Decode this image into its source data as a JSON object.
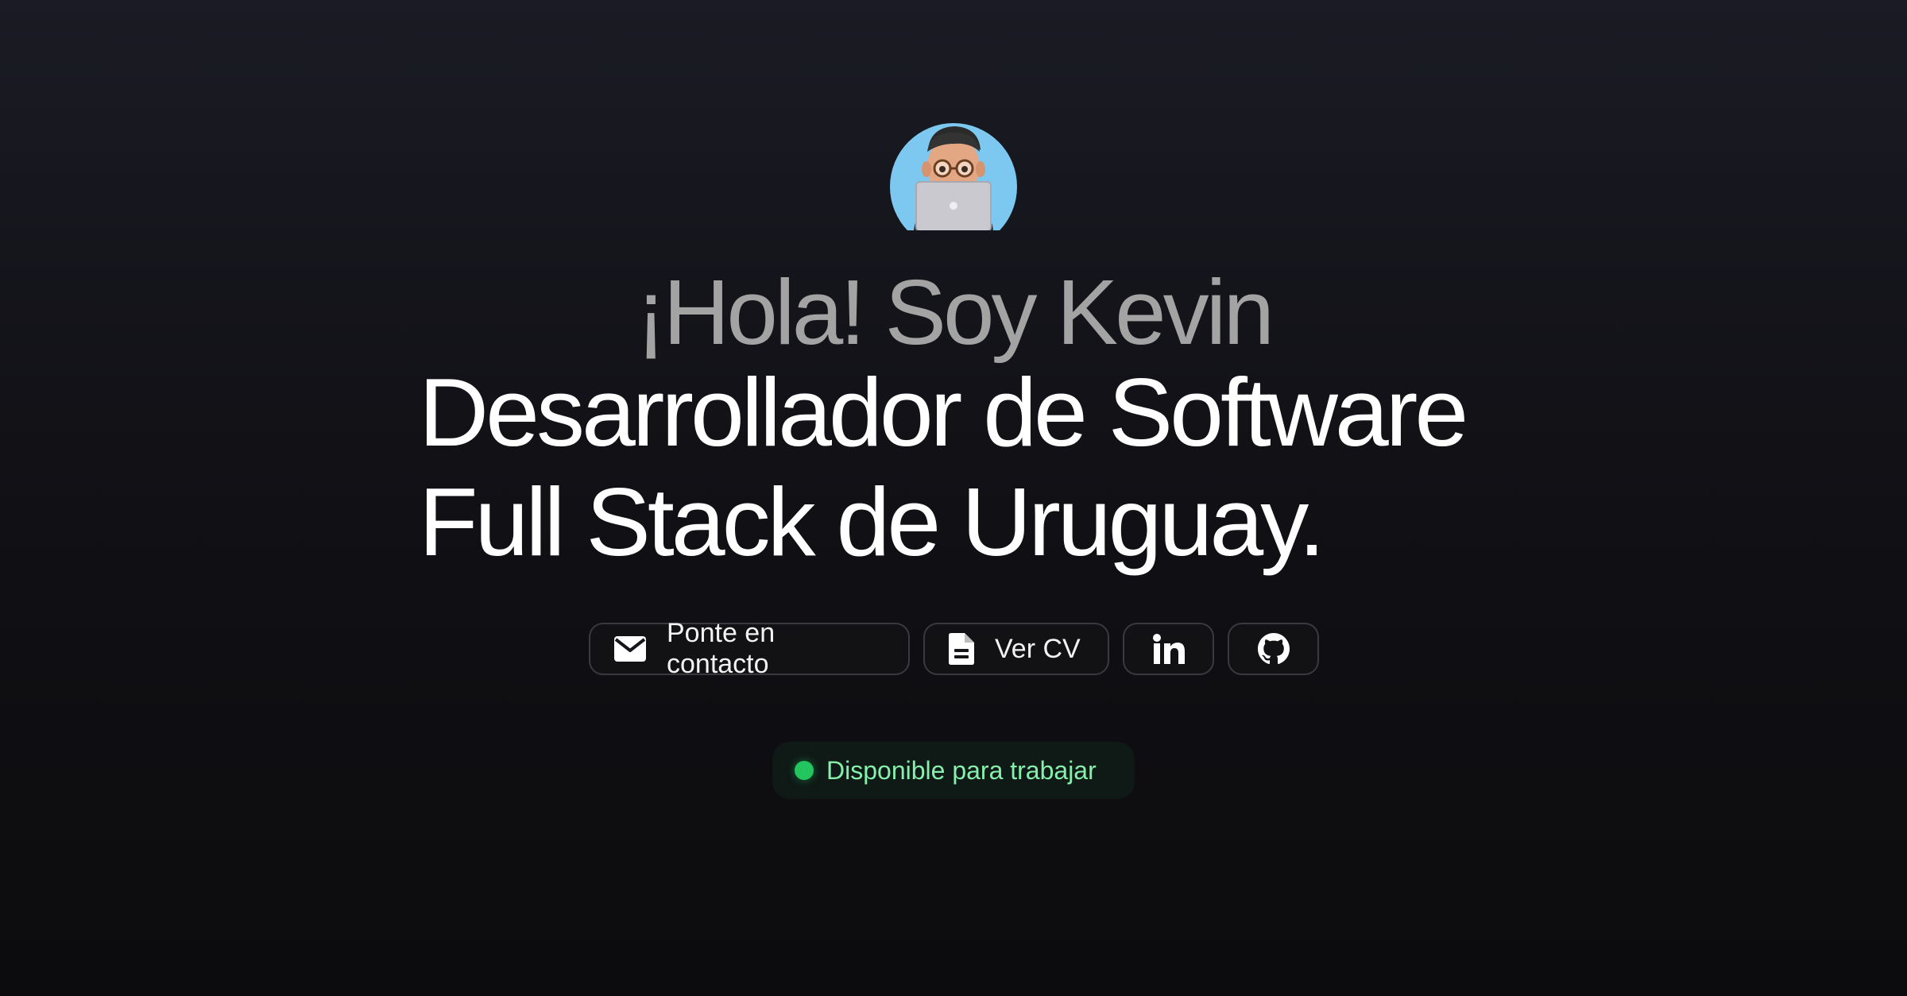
{
  "hero": {
    "avatar_icon": "memoji-developer-laptop-icon",
    "greeting": "¡Hola! Soy Kevin",
    "headline_line1": "Desarrollador de Software",
    "headline_line2": "Full Stack de Uruguay."
  },
  "actions": {
    "contact_label": "Ponte en contacto",
    "contact_icon": "mail-icon",
    "cv_label": "Ver CV",
    "cv_icon": "document-icon",
    "linkedin_icon": "linkedin-icon",
    "github_icon": "github-icon"
  },
  "status": {
    "label": "Disponible para trabajar",
    "color": "#22c55e"
  },
  "colors": {
    "background": "#111116",
    "greeting": "#a3a3a3",
    "headline": "#ffffff",
    "button_border": "#3a3a3e",
    "status_text": "#86efac"
  }
}
